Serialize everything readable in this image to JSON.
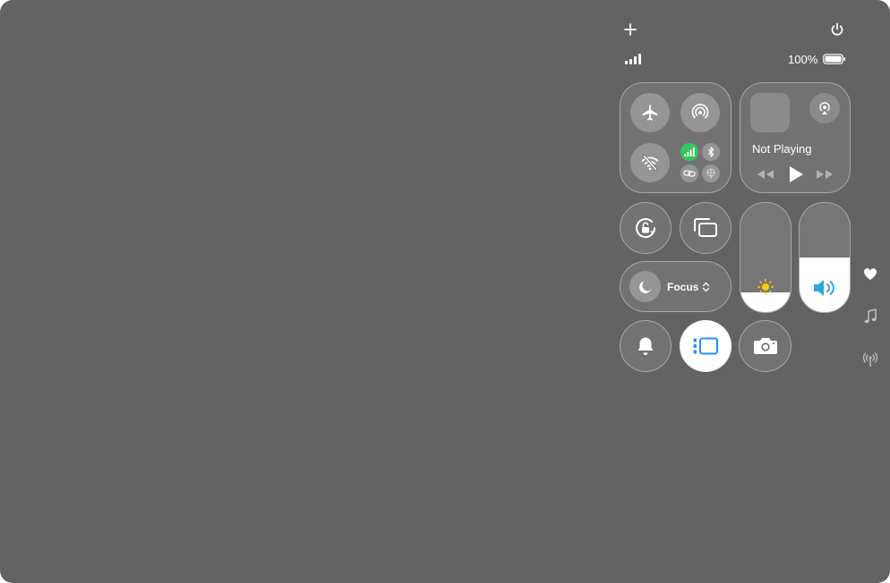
{
  "status": {
    "battery_text": "100%",
    "battery_level": 1.0
  },
  "media": {
    "now_playing": "Not Playing"
  },
  "focus": {
    "label": "Focus"
  },
  "sliders": {
    "brightness_level": 0.18,
    "volume_level": 0.5
  },
  "controls": {
    "add": "plus-icon",
    "power": "power-icon",
    "airplane": "airplane-icon",
    "airdrop": "airdrop-icon",
    "wifi": "wifi-off-icon",
    "cellular": "cellular-data-icon",
    "bluetooth": "bluetooth-icon",
    "personal_hotspot": "hotspot-icon",
    "vpn": "vpn-icon",
    "rotation_lock": "rotation-lock-icon",
    "screen_mirroring": "screen-mirroring-icon",
    "silent": "bell-icon",
    "stage_manager": "stage-manager-icon",
    "camera": "camera-icon"
  },
  "side_pages": [
    "heart-icon",
    "music-note-icon",
    "antenna-icon"
  ],
  "colors": {
    "background": "#636365",
    "accent_blue": "#1e90ff",
    "cellular_green": "#34c759",
    "sun_yellow": "#ffcc00",
    "volume_blue": "#2aa8e0"
  }
}
